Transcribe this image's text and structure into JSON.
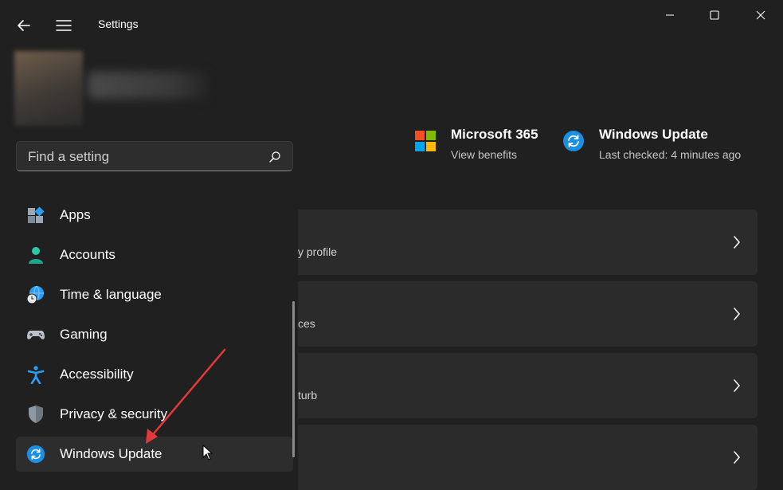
{
  "window": {
    "title": "Settings",
    "controls": {
      "minimize": "minimize",
      "maximize": "maximize",
      "close": "close"
    }
  },
  "search": {
    "placeholder": "Find a setting"
  },
  "sidebar": {
    "items": [
      {
        "label": "Apps",
        "icon": "apps-icon"
      },
      {
        "label": "Accounts",
        "icon": "accounts-icon"
      },
      {
        "label": "Time & language",
        "icon": "time-language-icon"
      },
      {
        "label": "Gaming",
        "icon": "gaming-icon"
      },
      {
        "label": "Accessibility",
        "icon": "accessibility-icon"
      },
      {
        "label": "Privacy & security",
        "icon": "privacy-shield-icon"
      },
      {
        "label": "Windows Update",
        "icon": "windows-update-icon",
        "selected": true
      }
    ]
  },
  "quick_links": [
    {
      "title": "Microsoft 365",
      "subtitle": "View benefits",
      "icon": "microsoft-logo-icon"
    },
    {
      "title": "Windows Update",
      "subtitle": "Last checked: 4 minutes ago",
      "icon": "windows-update-icon"
    }
  ],
  "cards": [
    {
      "subtitle": "y profile"
    },
    {
      "subtitle": "ces"
    },
    {
      "subtitle": "turb"
    },
    {
      "subtitle": ""
    }
  ],
  "colors": {
    "background": "#202020",
    "card": "#2b2b2b",
    "accent_blue": "#0f8fe0",
    "annotation_arrow": "#e23a3a"
  }
}
